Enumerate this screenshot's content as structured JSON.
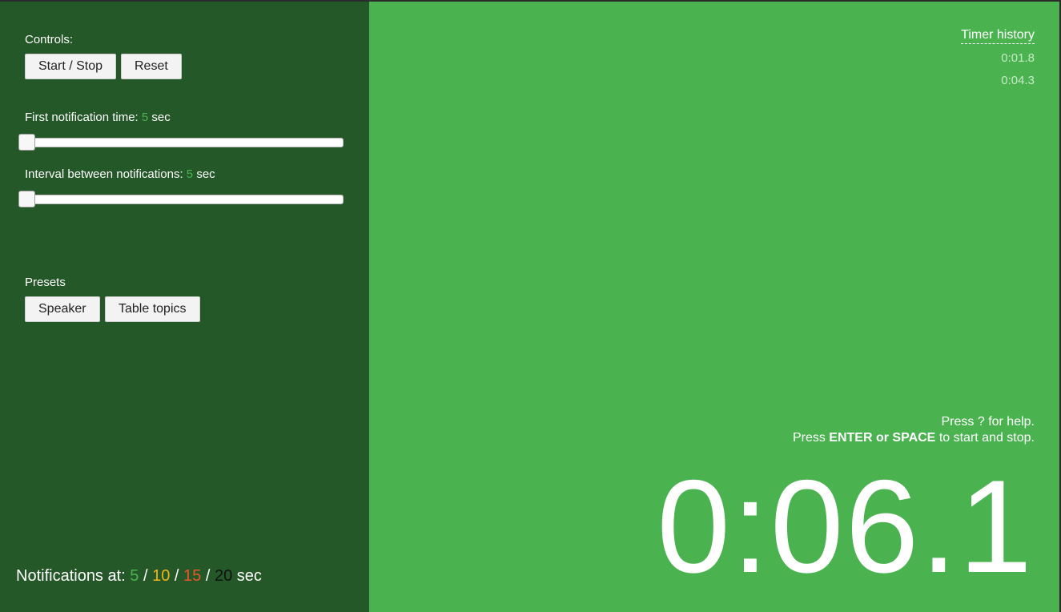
{
  "controls": {
    "heading": "Controls:",
    "start_stop_label": "Start / Stop",
    "reset_label": "Reset"
  },
  "first_notification": {
    "label": "First notification time:",
    "value": "5",
    "unit": "sec",
    "slider_fraction": 0.0
  },
  "interval": {
    "label": "Interval between notifications:",
    "value": "5",
    "unit": "sec",
    "slider_fraction": 0.0
  },
  "presets": {
    "heading": "Presets",
    "items": [
      "Speaker",
      "Table topics"
    ]
  },
  "notifications": {
    "label": "Notifications at:",
    "values": [
      {
        "value": "5",
        "color": "#4ab34f"
      },
      {
        "value": "10",
        "color": "#f2b418"
      },
      {
        "value": "15",
        "color": "#e8562a"
      },
      {
        "value": "20",
        "color": "#111111"
      }
    ],
    "separator": "/",
    "unit": "sec"
  },
  "history": {
    "title": "Timer history",
    "items": [
      "0:01.8",
      "0:04.3"
    ]
  },
  "help": {
    "line1": "Press ? for help.",
    "line2_prefix": "Press",
    "line2_keys": "ENTER or SPACE",
    "line2_suffix": "to start and stop."
  },
  "timer": {
    "display": "0:06.1"
  },
  "colors": {
    "left_panel_bg": "#245828",
    "right_panel_bg": "#4ab34f",
    "accent": "#4ab34f"
  }
}
